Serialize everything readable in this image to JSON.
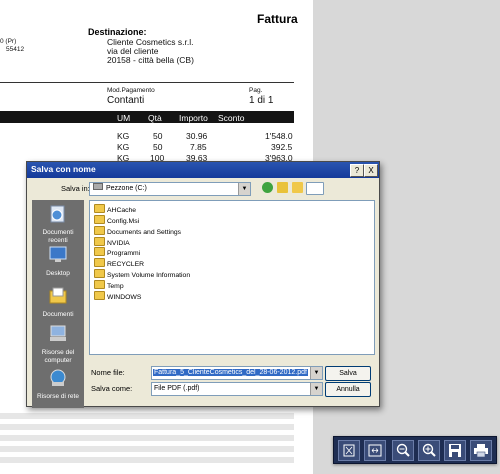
{
  "invoice": {
    "title": "Fattura",
    "sender_line1": "0 (Pr)",
    "sender_line2": "55412",
    "dest_label": "Destinazione:",
    "dest_name": "Cliente Cosmetics s.r.l.",
    "dest_street": "via del cliente",
    "dest_city": "20158 - città bella (CB)",
    "payment_label": "Mod.Pagamento",
    "payment_value": "Contanti",
    "page_label": "Pag.",
    "page_value": "1 di 1",
    "columns": [
      "UM",
      "Qtà",
      "Importo",
      "Sconto"
    ],
    "rows": [
      {
        "um": "KG",
        "qty": "50",
        "price": "30.96",
        "discount": "",
        "total": "1'548.0"
      },
      {
        "um": "KG",
        "qty": "50",
        "price": "7.85",
        "discount": "",
        "total": "392.5"
      },
      {
        "um": "KG",
        "qty": "100",
        "price": "39.63",
        "discount": "",
        "total": "3'963.0"
      }
    ]
  },
  "dialog": {
    "title": "Salva con nome",
    "help": "?",
    "close": "X",
    "save_in_label": "Salva in:",
    "save_in_value": "Pezzone (C:)",
    "places": [
      {
        "label": "Documenti recenti",
        "icon": "recent-docs-icon"
      },
      {
        "label": "Desktop",
        "icon": "desktop-icon"
      },
      {
        "label": "Documenti",
        "icon": "documents-icon"
      },
      {
        "label": "Risorse del computer",
        "icon": "my-computer-icon"
      },
      {
        "label": "Risorse di rete",
        "icon": "network-icon"
      }
    ],
    "files": [
      "AHCache",
      "Config.Msi",
      "Documents and Settings",
      "NVIDIA",
      "Programmi",
      "RECYCLER",
      "System Volume Information",
      "Temp",
      "WINDOWS"
    ],
    "filename_label": "Nome file:",
    "filename_value": "Fattura_5_ClienteCosmetics_del_28-06-2012.pdf",
    "filetype_label": "Salva come:",
    "filetype_value": "File PDF (.pdf)",
    "save_button": "Salva",
    "cancel_button": "Annulla"
  },
  "toolbar": {
    "buttons": [
      "fit-page-icon",
      "fit-width-icon",
      "zoom-out-icon",
      "zoom-in-icon",
      "save-icon",
      "print-icon"
    ],
    "colors": {
      "bar": "#1e2d52",
      "button": "#3a4c78"
    }
  }
}
